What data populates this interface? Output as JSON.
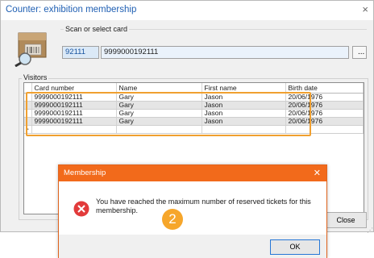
{
  "window": {
    "title": "Counter: exhibition membership",
    "close_glyph": "×"
  },
  "card": {
    "icon": "card-scanner-icon",
    "group_label": "Scan or select card",
    "prefix": "92111",
    "number": "9999000192111",
    "browse_label": "..."
  },
  "visitors": {
    "group_label": "Visitors",
    "columns": [
      "Card number",
      "Name",
      "First name",
      "Birth date"
    ],
    "rows": [
      [
        "9999000192111",
        "Gary",
        "Jason",
        "20/06/1976"
      ],
      [
        "9999000192111",
        "Gary",
        "Jason",
        "20/06/1976"
      ],
      [
        "9999000192111",
        "Gary",
        "Jason",
        "20/06/1976"
      ],
      [
        "9999000192111",
        "Gary",
        "Jason",
        "20/06/1976"
      ]
    ],
    "new_row_marker": "▸",
    "highlight_color": "#f0a030"
  },
  "footer": {
    "close_label": "Close"
  },
  "dialog": {
    "title": "Membership",
    "close_glyph": "✕",
    "title_color": "#f26a1b",
    "icon": "error-icon",
    "message": "You have reached the maximum number of reserved tickets for this membership.",
    "step_number": "2",
    "ok_label": "OK"
  }
}
